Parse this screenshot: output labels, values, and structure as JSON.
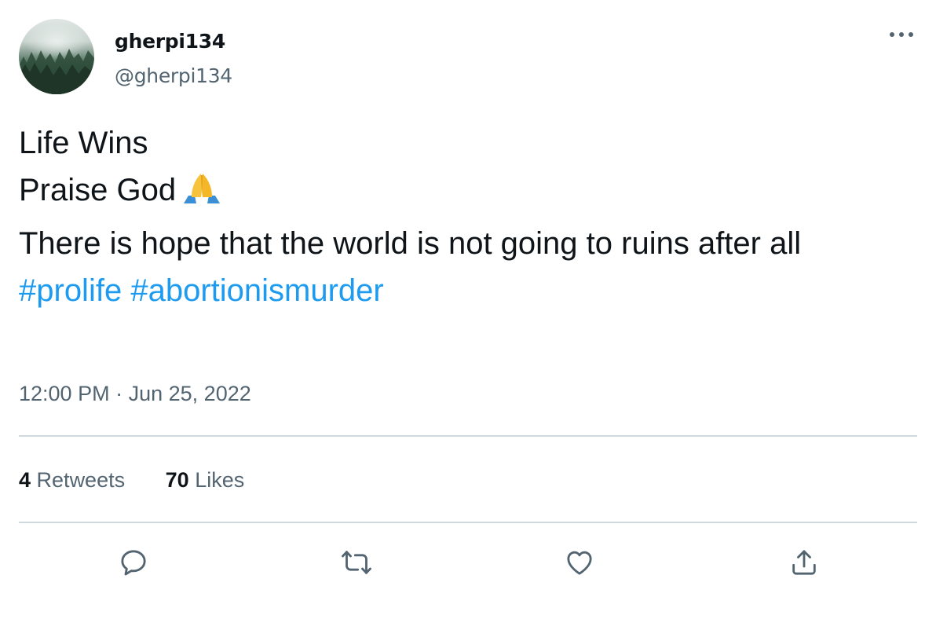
{
  "user": {
    "display_name": "gherpi134",
    "handle": "@gherpi134",
    "avatar_icon": "misty-forest-avatar"
  },
  "tweet": {
    "lines": [
      "Life Wins",
      "Praise God",
      "There is hope that the world is not going to ruins after all"
    ],
    "emoji": "folded-hands-emoji",
    "hashtags": [
      "#prolife",
      "#abortionismurder"
    ]
  },
  "meta": {
    "time": "12:00 PM",
    "separator": "·",
    "date": "Jun 25, 2022"
  },
  "stats": {
    "retweets_count": "4",
    "retweets_label": "Retweets",
    "likes_count": "70",
    "likes_label": "Likes"
  },
  "actions": [
    "reply-icon",
    "retweet-icon",
    "like-icon",
    "share-icon"
  ],
  "colors": {
    "text": "#0f1419",
    "secondary": "#536471",
    "link": "#1d9bf0",
    "divider": "#cfd9de"
  }
}
